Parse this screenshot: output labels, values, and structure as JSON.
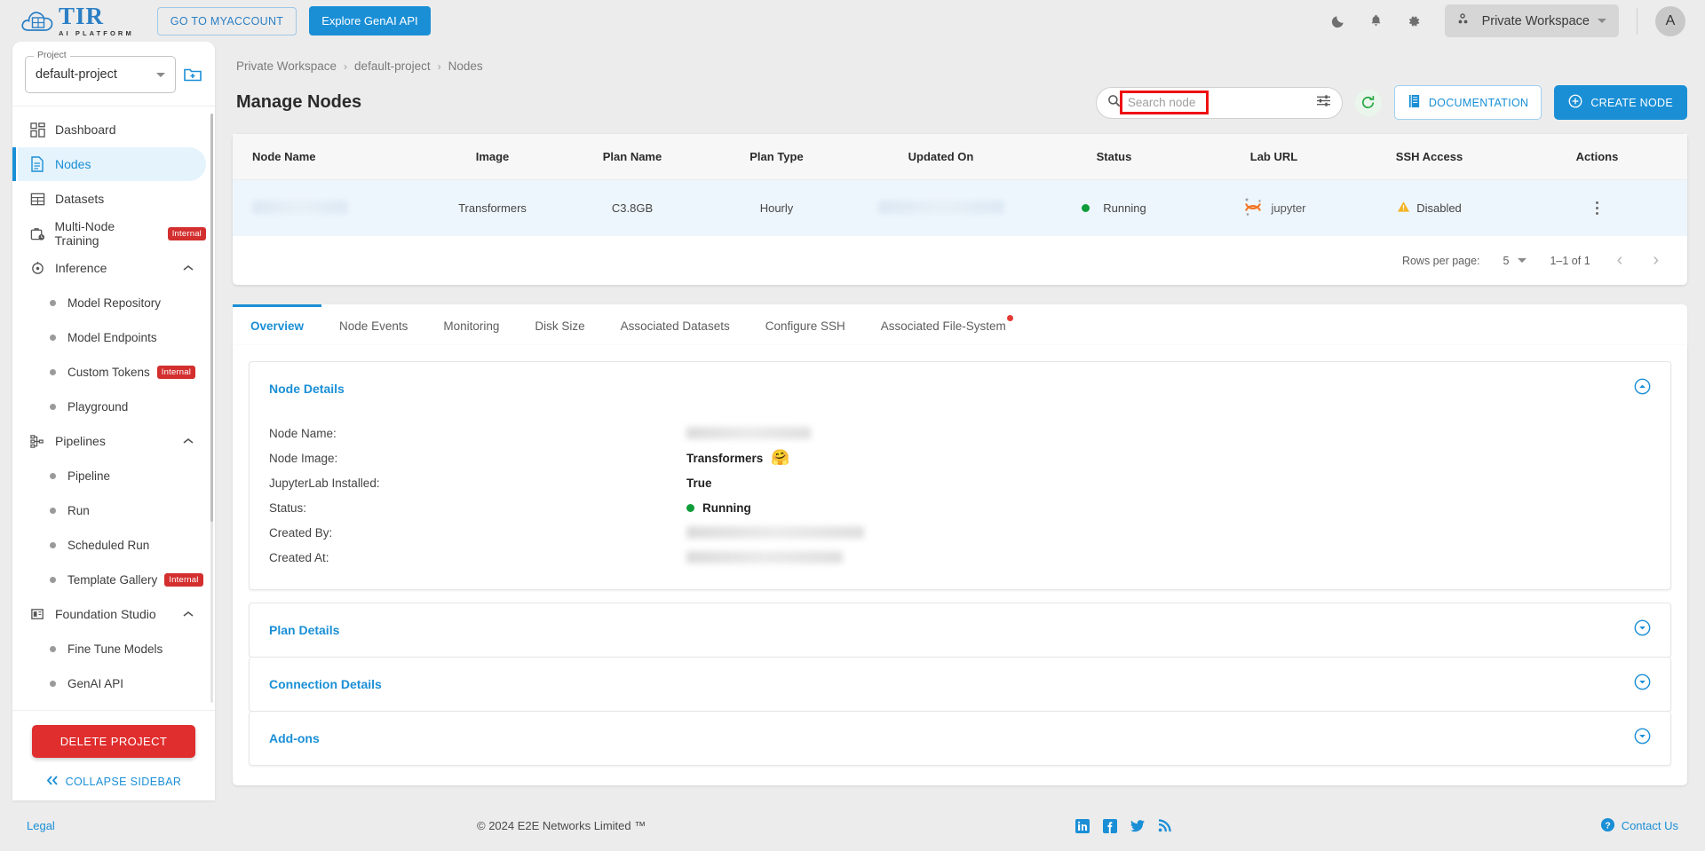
{
  "topbar": {
    "logo_name": "TIR",
    "logo_sub": "AI PLATFORM",
    "myaccount_label": "GO TO MYACCOUNT",
    "genai_label": "Explore GenAI API",
    "theme_icon": "moon-icon",
    "bell_icon": "bell-icon",
    "gear_icon": "gear-icon",
    "workspace_label": "Private Workspace",
    "avatar_initial": "A"
  },
  "sidebar": {
    "project_field_label": "Project",
    "project_value": "default-project",
    "new_project_icon": "folder-add-icon",
    "items": [
      {
        "label": "Dashboard",
        "icon": "dashboard-icon",
        "type": "top",
        "active": false
      },
      {
        "label": "Nodes",
        "icon": "document-icon",
        "type": "top",
        "active": true
      },
      {
        "label": "Datasets",
        "icon": "grid-icon",
        "type": "top",
        "active": false
      },
      {
        "label": "Multi-Node Training",
        "icon": "briefcase-clock-icon",
        "type": "top",
        "badge": "Internal"
      },
      {
        "label": "Inference",
        "icon": "inference-icon",
        "type": "group",
        "expanded": true
      },
      {
        "label": "Model Repository",
        "type": "sub"
      },
      {
        "label": "Model Endpoints",
        "type": "sub"
      },
      {
        "label": "Custom Tokens",
        "type": "sub",
        "badge": "Internal"
      },
      {
        "label": "Playground",
        "type": "sub"
      },
      {
        "label": "Pipelines",
        "icon": "pipeline-icon",
        "type": "group",
        "expanded": true
      },
      {
        "label": "Pipeline",
        "type": "sub"
      },
      {
        "label": "Run",
        "type": "sub"
      },
      {
        "label": "Scheduled Run",
        "type": "sub"
      },
      {
        "label": "Template Gallery",
        "type": "sub",
        "badge": "Internal"
      },
      {
        "label": "Foundation Studio",
        "icon": "studio-icon",
        "type": "group",
        "expanded": true
      },
      {
        "label": "Fine Tune Models",
        "type": "sub"
      },
      {
        "label": "GenAI API",
        "type": "sub"
      }
    ],
    "delete_project_label": "DELETE PROJECT",
    "collapse_label": "COLLAPSE SIDEBAR"
  },
  "breadcrumb": [
    "Private Workspace",
    "default-project",
    "Nodes"
  ],
  "page": {
    "title": "Manage Nodes",
    "search_placeholder": "Search node",
    "search_value": "",
    "search_icon": "search-icon",
    "filter_icon": "filter-settings-icon",
    "refresh_icon": "refresh-icon",
    "documentation_label": "DOCUMENTATION",
    "create_node_label": "CREATE NODE"
  },
  "table": {
    "columns": [
      "Node Name",
      "Image",
      "Plan Name",
      "Plan Type",
      "Updated On",
      "Status",
      "Lab URL",
      "SSH Access",
      "Actions"
    ],
    "rows": [
      {
        "node_name": "",
        "image": "Transformers",
        "plan_name": "C3.8GB",
        "plan_type": "Hourly",
        "updated_on": "",
        "status": "Running",
        "lab_url": "jupyter",
        "ssh_access": "Disabled"
      }
    ],
    "pagination": {
      "rows_per_page_label": "Rows per page:",
      "rows_per_page_value": "5",
      "range_label": "1–1 of 1"
    }
  },
  "tabs": [
    {
      "label": "Overview",
      "active": true
    },
    {
      "label": "Node Events",
      "active": false
    },
    {
      "label": "Monitoring",
      "active": false
    },
    {
      "label": "Disk Size",
      "active": false
    },
    {
      "label": "Associated Datasets",
      "active": false
    },
    {
      "label": "Configure SSH",
      "active": false
    },
    {
      "label": "Associated File-System",
      "active": false,
      "badge_dot": true
    }
  ],
  "node_details": {
    "title": "Node Details",
    "toggle_icon": "chevron-up-circle-icon",
    "rows": [
      {
        "label": "Node Name:",
        "value": "",
        "redacted": true
      },
      {
        "label": "Node Image:",
        "value": "Transformers",
        "emoji": "🤗"
      },
      {
        "label": "JupyterLab Installed:",
        "value": "True"
      },
      {
        "label": "Status:",
        "value": "Running",
        "status_dot": "#0f9d3a"
      },
      {
        "label": "Created By:",
        "value": "",
        "redacted": true
      },
      {
        "label": "Created At:",
        "value": "",
        "redacted": true
      }
    ]
  },
  "accordions": [
    {
      "title": "Plan Details",
      "toggle_icon": "chevron-down-circle-icon"
    },
    {
      "title": "Connection Details",
      "toggle_icon": "chevron-down-circle-icon"
    },
    {
      "title": "Add-ons",
      "toggle_icon": "chevron-down-circle-icon"
    }
  ],
  "footer": {
    "legal": "Legal",
    "copyright": "© 2024 E2E Networks Limited ™",
    "socials": [
      "linkedin-icon",
      "facebook-icon",
      "twitter-icon",
      "rss-icon"
    ],
    "contact": "Contact Us",
    "contact_icon": "help-circle-icon"
  },
  "colors": {
    "accent": "#1a8fd6",
    "danger": "#d32f2f",
    "success": "#0f9d3a",
    "warning": "#f5b324",
    "highlight": "#ee1111"
  }
}
